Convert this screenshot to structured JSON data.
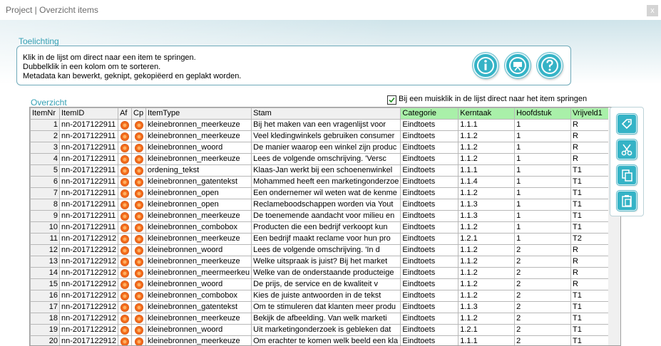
{
  "window": {
    "title": "Project | Overzicht items",
    "close_label": "x"
  },
  "toelichting": {
    "label": "Toelichting",
    "lines": [
      "Klik in de lijst om direct naar een item te springen.",
      "Dubbelklik in een kolom om te sorteren.",
      "Metadata kan bewerkt, geknipt, gekopiëerd en geplakt worden."
    ],
    "buttons": [
      "info-icon",
      "projector-icon",
      "help-icon"
    ]
  },
  "overzicht": {
    "label": "Overzicht",
    "checkbox": {
      "checked": true,
      "label": "Bij een muisklik in de lijst direct naar het item springen"
    }
  },
  "table": {
    "columns": [
      "ItemNr",
      "ItemID",
      "Af",
      "Cp",
      "ItemType",
      "Stam",
      "Categorie",
      "Kerntaak",
      "Hoofdstuk",
      "Vrijveld1"
    ],
    "highlight_color": "#a9f0a9",
    "status_color": "#f26a1b",
    "rows": [
      [
        "1",
        "nn-2017122911",
        "",
        "",
        "kleinebronnen_meerkeuze",
        "Bij het maken van een vragenlijst voor",
        "Eindtoets",
        "1.1.1",
        "1",
        "R"
      ],
      [
        "2",
        "nn-2017122911",
        "",
        "",
        "kleinebronnen_meerkeuze",
        "Veel kledingwinkels gebruiken consumer",
        "Eindtoets",
        "1.1.2",
        "1",
        "R"
      ],
      [
        "3",
        "nn-2017122911",
        "",
        "",
        "kleinebronnen_woord",
        "De manier waarop een winkel zijn produc",
        "Eindtoets",
        "1.1.2",
        "1",
        "R"
      ],
      [
        "4",
        "nn-2017122911",
        "",
        "",
        "kleinebronnen_meerkeuze",
        "Lees de volgende omschrijving.  'Versc",
        "Eindtoets",
        "1.1.2",
        "1",
        "R"
      ],
      [
        "5",
        "nn-2017122911",
        "",
        "",
        "ordening_tekst",
        "Klaas-Jan werkt bij een schoenenwinkel",
        "Eindtoets",
        "1.1.1",
        "1",
        "T1"
      ],
      [
        "6",
        "nn-2017122911",
        "",
        "",
        "kleinebronnen_gatentekst",
        "Mohammed heeft een marketingonderzoe",
        "Eindtoets",
        "1.1.4",
        "1",
        "T1"
      ],
      [
        "7",
        "nn-2017122911",
        "",
        "",
        "kleinebronnen_open",
        "Een ondernemer wil weten wat de kenme",
        "Eindtoets",
        "1.1.2",
        "1",
        "T1"
      ],
      [
        "8",
        "nn-2017122911",
        "",
        "",
        "kleinebronnen_open",
        "Reclameboodschappen worden via Yout",
        "Eindtoets",
        "1.1.3",
        "1",
        "T1"
      ],
      [
        "9",
        "nn-2017122911",
        "",
        "",
        "kleinebronnen_meerkeuze",
        "De toenemende aandacht voor milieu en",
        "Eindtoets",
        "1.1.3",
        "1",
        "T1"
      ],
      [
        "10",
        "nn-2017122911",
        "",
        "",
        "kleinebronnen_combobox",
        "Producten die een bedrijf verkoopt kun",
        "Eindtoets",
        "1.1.2",
        "1",
        "T1"
      ],
      [
        "11",
        "nn-2017122912",
        "",
        "",
        "kleinebronnen_meerkeuze",
        "Een bedrijf maakt reclame voor hun pro",
        "Eindtoets",
        "1.2.1",
        "1",
        "T2"
      ],
      [
        "12",
        "nn-2017122912",
        "",
        "",
        "kleinebronnen_woord",
        "Lees de volgende omschrijving.  'In d",
        "Eindtoets",
        "1.1.2",
        "2",
        "R"
      ],
      [
        "13",
        "nn-2017122912",
        "",
        "",
        "kleinebronnen_meerkeuze",
        "Welke uitspraak is juist? Bij het market",
        "Eindtoets",
        "1.1.2",
        "2",
        "R"
      ],
      [
        "14",
        "nn-2017122912",
        "",
        "",
        "kleinebronnen_meermeerkeu",
        "Welke van de onderstaande producteige",
        "Eindtoets",
        "1.1.2",
        "2",
        "R"
      ],
      [
        "15",
        "nn-2017122912",
        "",
        "",
        "kleinebronnen_woord",
        "De prijs, de service en de kwaliteit v",
        "Eindtoets",
        "1.1.2",
        "2",
        "R"
      ],
      [
        "16",
        "nn-2017122912",
        "",
        "",
        "kleinebronnen_combobox",
        "Kies de juiste antwoorden in de tekst",
        "Eindtoets",
        "1.1.2",
        "2",
        "T1"
      ],
      [
        "17",
        "nn-2017122912",
        "",
        "",
        "kleinebronnen_gatentekst",
        "Om te stimuleren dat klanten meer produ",
        "Eindtoets",
        "1.1.3",
        "2",
        "T1"
      ],
      [
        "18",
        "nn-2017122912",
        "",
        "",
        "kleinebronnen_meerkeuze",
        "Bekijk de afbeelding.  Van welk marketi",
        "Eindtoets",
        "1.1.2",
        "2",
        "T1"
      ],
      [
        "19",
        "nn-2017122912",
        "",
        "",
        "kleinebronnen_woord",
        "Uit marketingonderzoek is gebleken dat",
        "Eindtoets",
        "1.2.1",
        "2",
        "T1"
      ],
      [
        "20",
        "nn-2017122912",
        "",
        "",
        "kleinebronnen_meerkeuze",
        "Om erachter te komen welk beeld een kla",
        "Eindtoets",
        "1.1.1",
        "2",
        "T1"
      ]
    ]
  },
  "side_buttons": [
    "tag-icon",
    "scissors-icon",
    "copy-icon",
    "paste-icon"
  ]
}
